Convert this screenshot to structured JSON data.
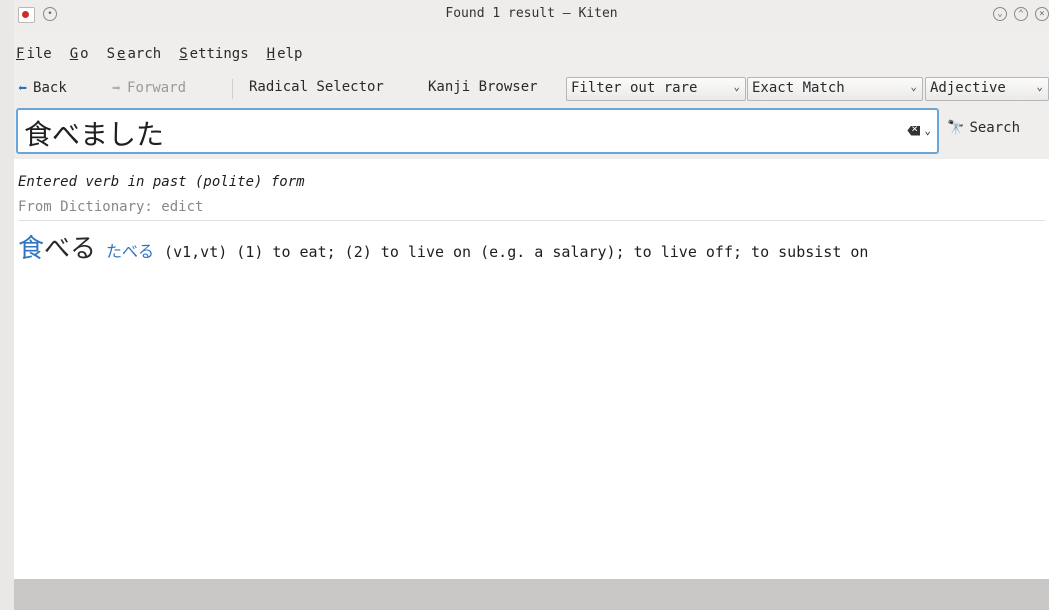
{
  "window": {
    "title": "Found 1 result – Kiten"
  },
  "menu": {
    "file": {
      "u": "F",
      "rest": "ile"
    },
    "go": {
      "u": "G",
      "rest": "o"
    },
    "search": {
      "pre": "S",
      "u": "e",
      "rest": "arch"
    },
    "settings": {
      "u": "S",
      "rest": "ettings"
    },
    "help": {
      "u": "H",
      "rest": "elp"
    }
  },
  "toolbar": {
    "back": "Back",
    "forward": "Forward",
    "radical_selector": "Radical Selector",
    "kanji_browser": "Kanji Browser",
    "filter_combo": "Filter out rare",
    "match_combo": "Exact Match",
    "type_combo": "Adjective"
  },
  "search": {
    "query": "食べました",
    "button_label": "Search"
  },
  "results": {
    "deinflection_note": "Entered verb in past (polite) form",
    "source": "From Dictionary: edict",
    "entries": [
      {
        "kanji": "食",
        "kana_suffix": "べる",
        "reading": "たべる",
        "definition": "(v1,vt) (1) to eat; (2) to live on (e.g. a salary); to live off; to subsist on"
      }
    ]
  },
  "icons": {
    "back": "arrow-left-icon",
    "forward": "arrow-right-icon",
    "clear": "backspace-clear-icon",
    "search": "binoculars-icon"
  }
}
